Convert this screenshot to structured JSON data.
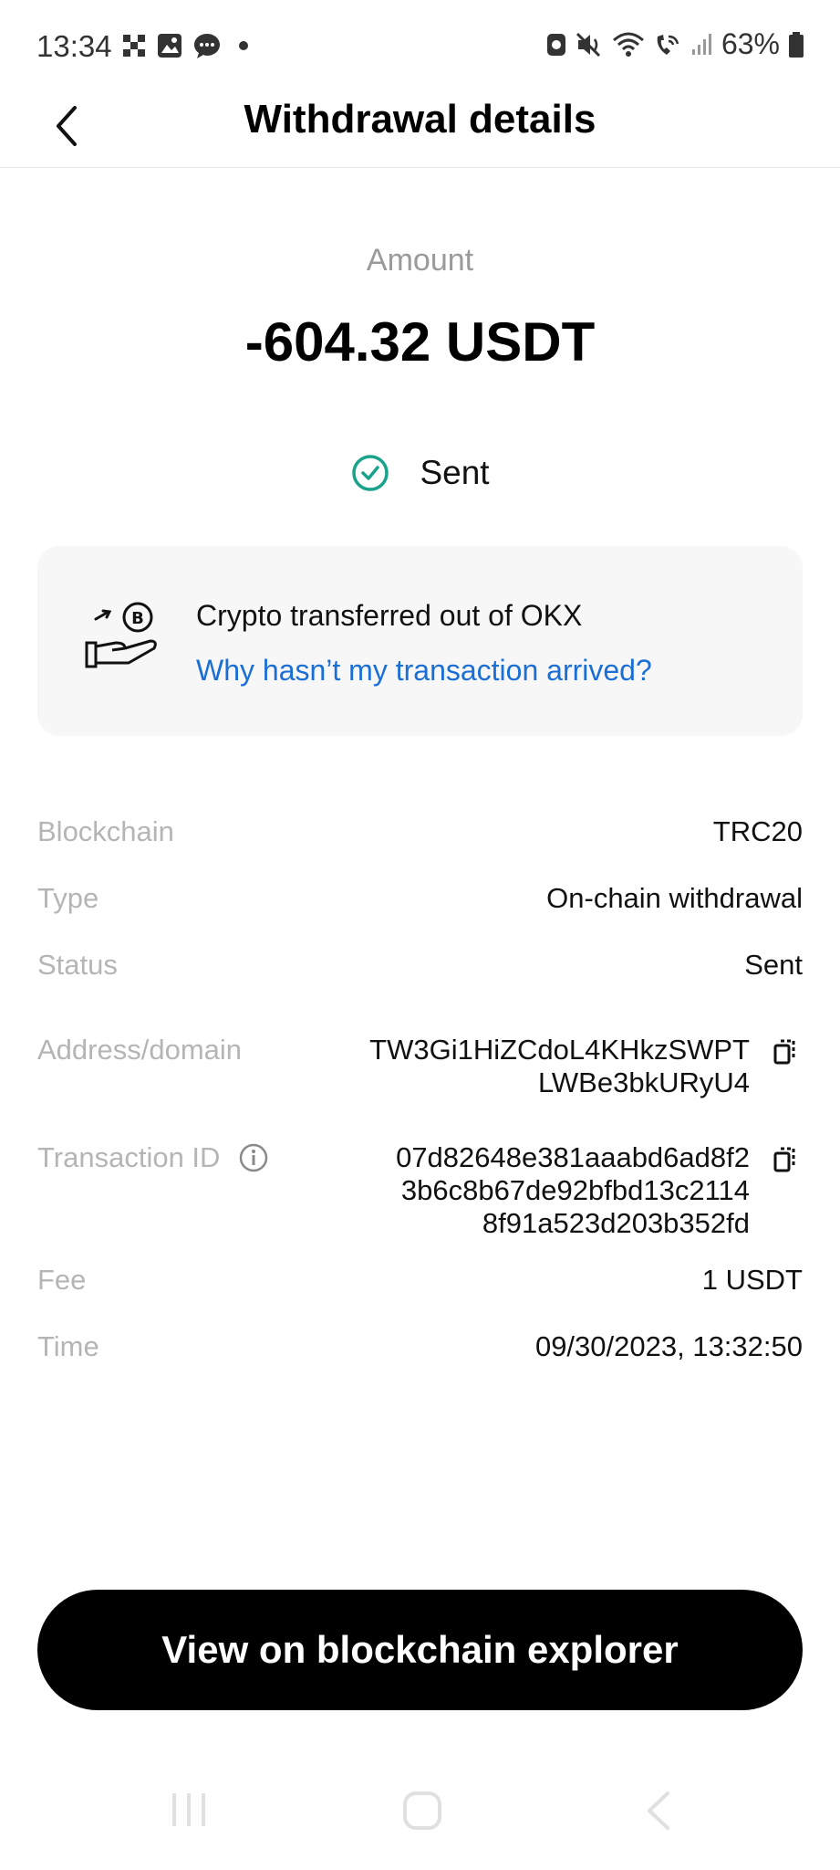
{
  "status_bar": {
    "time": "13:34",
    "battery": "63%"
  },
  "header": {
    "title": "Withdrawal details"
  },
  "amount": {
    "label": "Amount",
    "value": "-604.32 USDT"
  },
  "status_badge": {
    "text": "Sent",
    "color": "#1aa38b"
  },
  "info_card": {
    "text": "Crypto transferred out of OKX",
    "link": "Why hasn’t my transaction arrived?"
  },
  "details": {
    "blockchain": {
      "label": "Blockchain",
      "value": "TRC20"
    },
    "type": {
      "label": "Type",
      "value": "On-chain withdrawal"
    },
    "status": {
      "label": "Status",
      "value": "Sent"
    },
    "address": {
      "label": "Address/domain",
      "line1": "TW3Gi1HiZCdoL4KHkzSWPT",
      "line2": "LWBe3bkURyU4"
    },
    "txid": {
      "label": "Transaction ID",
      "line1": "07d82648e381aaabd6ad8f2",
      "line2": "3b6c8b67de92bfbd13c2114",
      "line3": "8f91a523d203b352fd"
    },
    "fee": {
      "label": "Fee",
      "value": "1 USDT"
    },
    "time": {
      "label": "Time",
      "value": "09/30/2023, 13:32:50"
    }
  },
  "button": {
    "label": "View on blockchain explorer"
  },
  "icons": {
    "back": "chevron-left-icon",
    "check": "check-circle-icon",
    "hand": "hand-coin-icon",
    "info": "info-icon",
    "copy": "copy-icon"
  },
  "colors": {
    "accent_link": "#1a6fd6",
    "success": "#1aa38b",
    "button_bg": "#000000"
  }
}
